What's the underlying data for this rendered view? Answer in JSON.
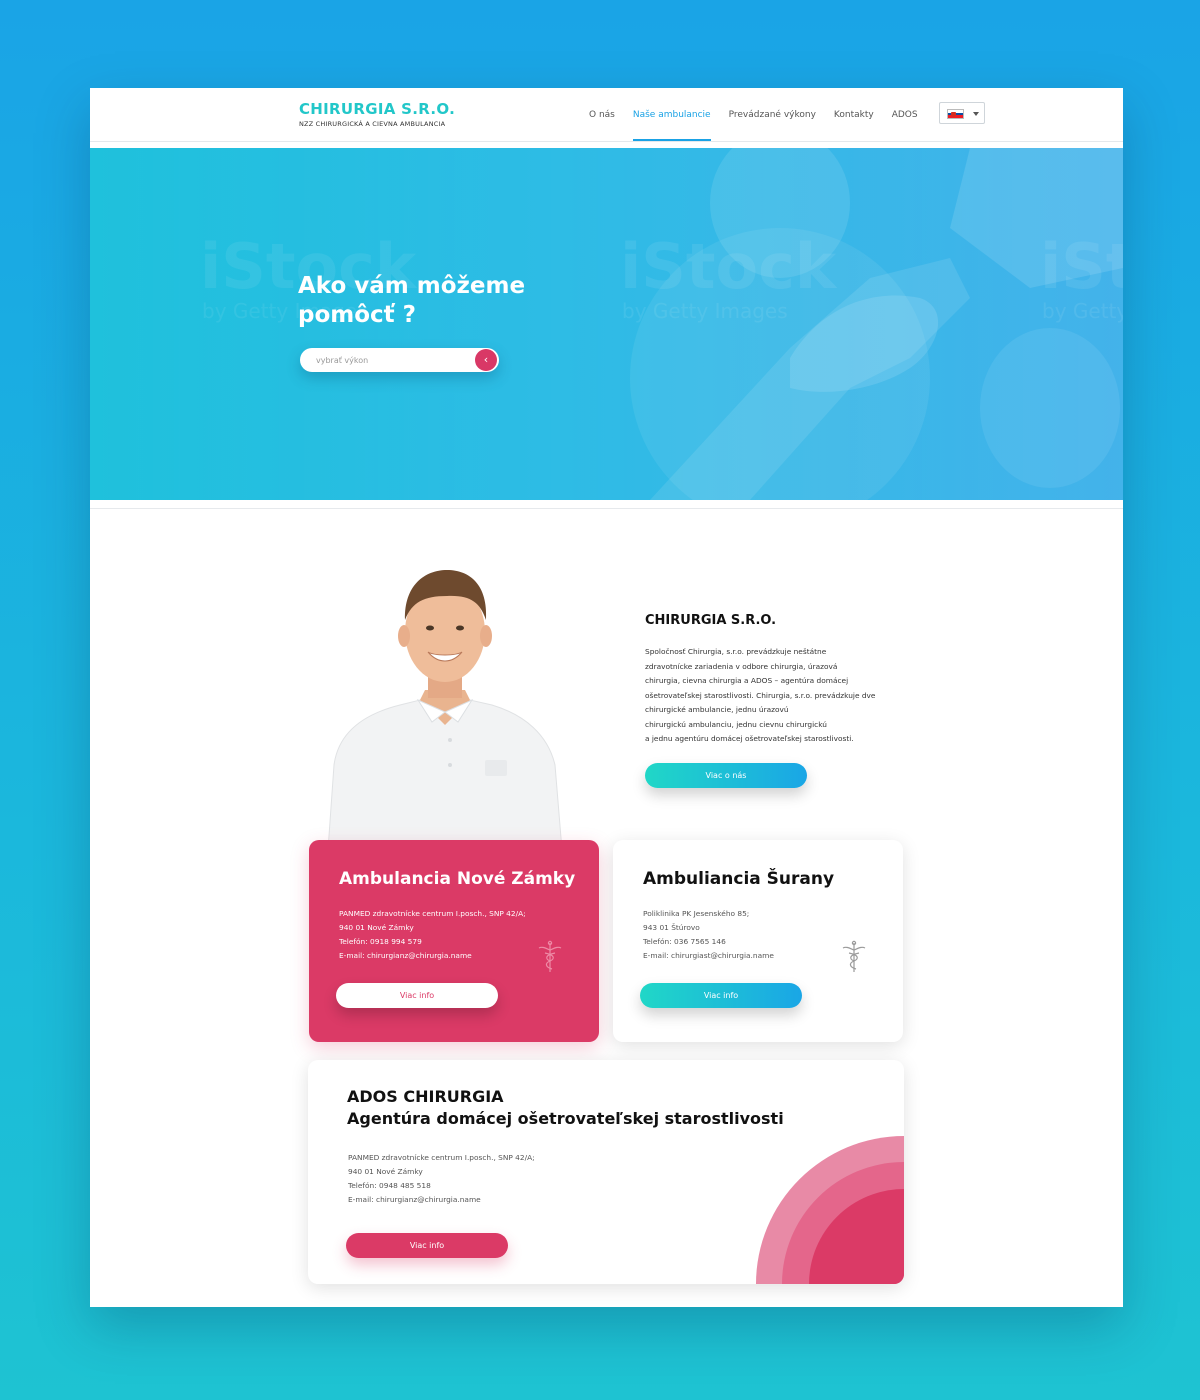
{
  "header": {
    "logo_title": "CHIRURGIA S.R.O.",
    "logo_subtitle": "NZZ CHIRURGICKÁ A CIEVNA AMBULANCIA",
    "nav": [
      {
        "label": "O nás",
        "active": false
      },
      {
        "label": "Naše ambulancie",
        "active": true
      },
      {
        "label": "Prevádzané výkony",
        "active": false
      },
      {
        "label": "Kontakty",
        "active": false
      },
      {
        "label": "ADOS",
        "active": false
      }
    ],
    "language_icon": "slovak-flag-icon"
  },
  "hero": {
    "title": "Ako vám môžeme pomôcť ?",
    "search_placeholder": "vybrať výkon",
    "search_button_icon": "chevron-left-icon",
    "watermark_1": "iStock",
    "watermark_2": "by Getty Images"
  },
  "about": {
    "title": "CHIRURGIA S.R.O.",
    "paragraph_lines": [
      "Spoločnosť Chirurgia, s.r.o. prevádzkuje neštátne",
      "zdravotnícke zariadenia v odbore chirurgia, úrazová",
      "chirurgia, cievna chirurgia a ADOS – agentúra domácej",
      "ošetrovateľskej starostlivosti. Chirurgia, s.r.o. prevádzkuje dve",
      "chirurgické ambulancie, jednu úrazovú",
      "chirurgickú ambulanciu, jednu cievnu chirurgickú",
      "a jednu agentúru domácej ošetrovateľskej starostlivosti."
    ],
    "button": "Viac o nás"
  },
  "cards": [
    {
      "title": "Ambulancia Nové Zámky",
      "lines": [
        "PANMED zdravotnícke centrum I.posch., SNP 42/A;",
        "940 01 Nové Zámky",
        "Telefón: 0918 994 579",
        "E-mail: chirurgianz@chirurgia.name"
      ],
      "button": "Viac info",
      "icon": "caduceus-icon"
    },
    {
      "title": "Ambuliancia Šurany",
      "lines": [
        "Poliklinika PK Jesenského 85;",
        "943 01 Štúrovo",
        "Telefón: 036 7565 146",
        "E-mail: chirurgiast@chirurgia.name"
      ],
      "button": "Viac info",
      "icon": "caduceus-icon"
    }
  ],
  "ados": {
    "title_line1": "ADOS CHIRURGIA",
    "title_line2": "Agentúra domácej ošetrovateľskej starostlivosti",
    "lines": [
      "PANMED zdravotnícke centrum I.posch., SNP 42/A;",
      "940 01 Nové Zámky",
      "Telefón: 0948 485 518",
      "E-mail: chirurgianz@chirurgia.name"
    ],
    "button": "Viac info"
  },
  "colors": {
    "accent_teal": "#22c7c9",
    "accent_blue": "#1aa2e5",
    "accent_pink": "#db3a66"
  }
}
